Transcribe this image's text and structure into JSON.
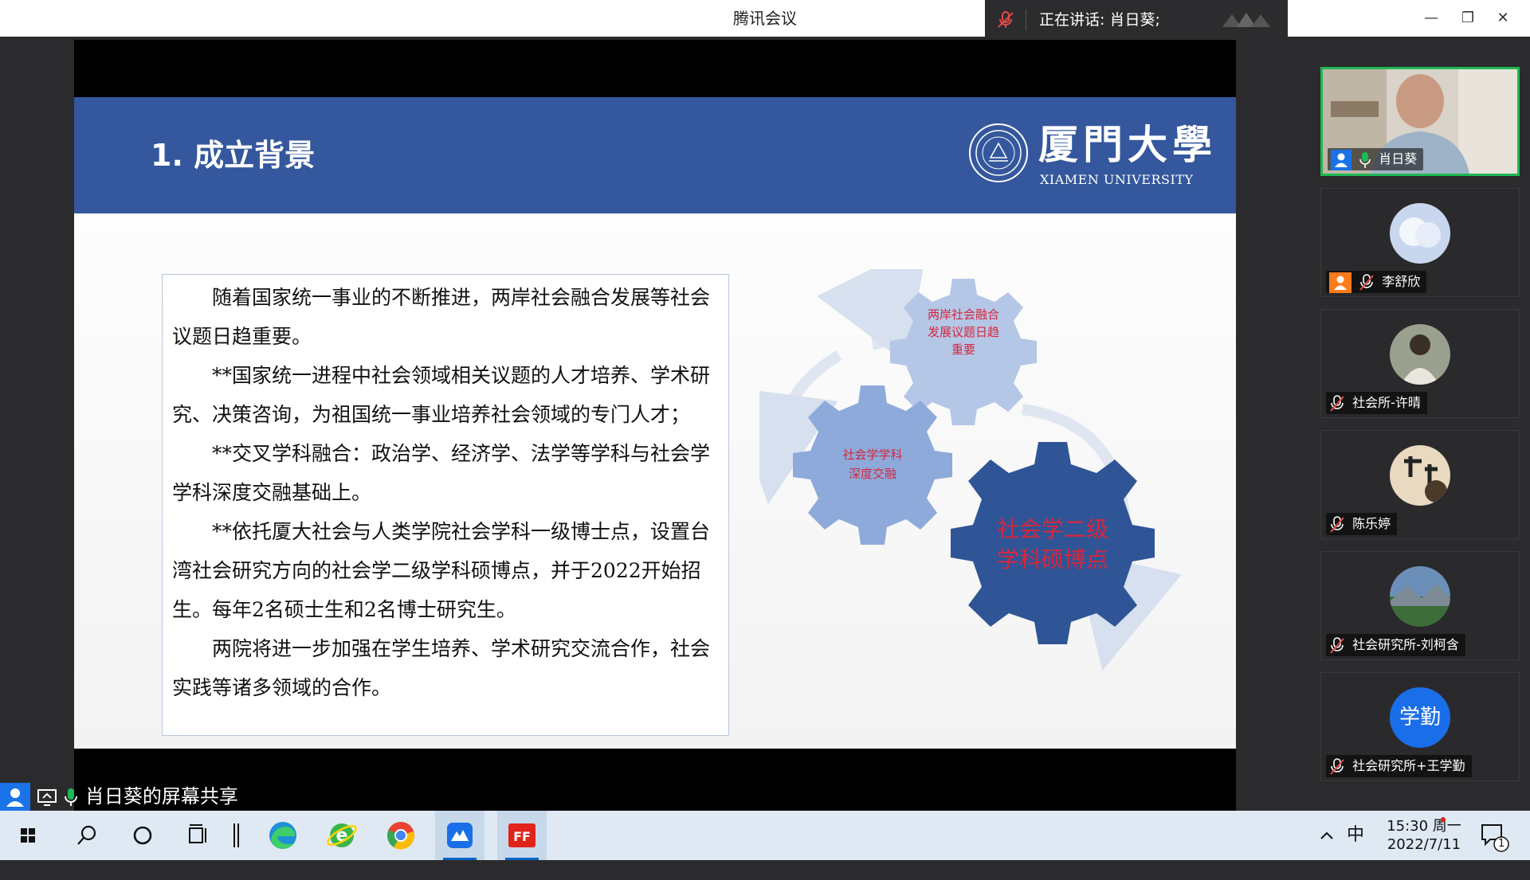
{
  "window": {
    "title": "腾讯会议",
    "speaking_label": "正在讲话: 肖日葵;",
    "minimize": "—",
    "restore": "❐",
    "close": "✕"
  },
  "slide": {
    "title": "1. 成立背景",
    "university_cn": "厦門大學",
    "university_en": "XIAMEN UNIVERSITY",
    "paragraphs": [
      "随着国家统一事业的不断推进，两岸社会融合发展等社会议题日趋重要。",
      "**国家统一进程中社会领域相关议题的人才培养、学术研究、决策咨询，为祖国统一事业培养社会领域的专门人才；",
      "**交叉学科融合：政治学、经济学、法学等学科与社会学学科深度交融基础上。",
      "**依托厦大社会与人类学院社会学科一级博士点，设置台湾社会研究方向的社会学二级学科硕博点，并于2022开始招生。每年2名硕士生和2名博士研究生。",
      "两院将进一步加强在学生培养、学术研究交流合作，社会实践等诸多领域的合作。"
    ],
    "gear_top_lines": [
      "两岸社会融合",
      "发展议题日趋",
      "重要"
    ],
    "gear_left_lines": [
      "社会学学科",
      "深度交融"
    ],
    "gear_big_lines": [
      "社会学二级",
      "学科硕博点"
    ]
  },
  "share_label": "肖日葵的屏幕共享",
  "participants": [
    {
      "name": "肖日葵",
      "type": "video",
      "mic": "on"
    },
    {
      "name": "李舒欣",
      "type": "avatar-sky",
      "mic": "muted"
    },
    {
      "name": "社会所-许晴",
      "type": "avatar-girl",
      "mic": "muted"
    },
    {
      "name": "陈乐婷",
      "type": "avatar-calligraphy",
      "mic": "muted"
    },
    {
      "name": "社会研究所-刘柯含",
      "type": "avatar-landscape",
      "mic": "muted"
    },
    {
      "name": "社会研究所+王学勤",
      "type": "avatar-text",
      "avatar_text": "学勤",
      "mic": "muted"
    }
  ],
  "taskbar": {
    "ime": "中",
    "time": "15:30 周一",
    "date": "2022/7/11",
    "notification_count": "1",
    "apps": [
      "start-icon",
      "search-icon",
      "cortana-icon",
      "task-view-icon",
      "edge-icon",
      "ie-icon",
      "chrome-icon",
      "tencent-meeting-icon",
      "foxit-icon"
    ]
  },
  "colors": {
    "slide_header": "#34579d",
    "gear_light": "#b4c7e7",
    "gear_mid": "#8eaadb",
    "gear_dark": "#2f5597",
    "gear_text": "#d7263d",
    "active_speaker_border": "#1db954"
  }
}
